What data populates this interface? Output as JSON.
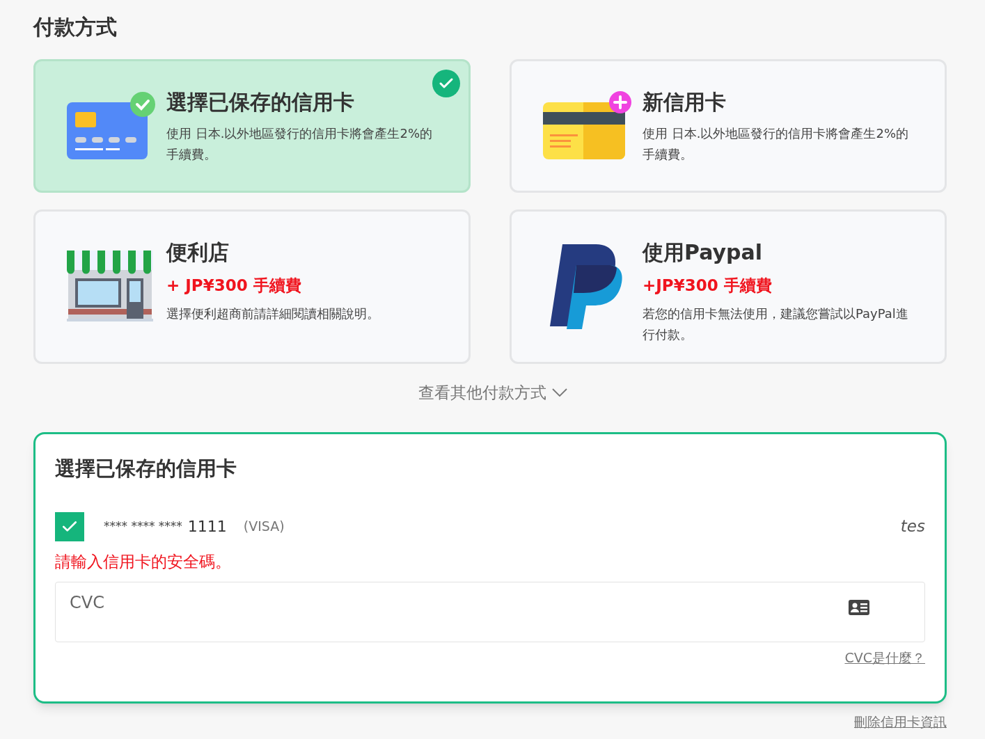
{
  "heading": "付款方式",
  "options": [
    {
      "kind": "saved_card",
      "title": "選擇已保存的信用卡",
      "description": "使用 日本.以外地區發行的信用卡將會產生2%的手續費。",
      "selected": true
    },
    {
      "kind": "new_card",
      "title": "新信用卡",
      "description": "使用 日本.以外地區發行的信用卡將會產生2%的手續費。",
      "selected": false
    },
    {
      "kind": "store",
      "title": "便利店",
      "fee": "+ JP¥300 手續費",
      "description": "選擇便利超商前請詳細閱讀相關說明。",
      "selected": false
    },
    {
      "kind": "paypal",
      "title": "使用Paypal",
      "fee": "+JP¥300 手續費",
      "description": "若您的信用卡無法使用，建議您嘗試以PayPal進行付款。",
      "selected": false
    }
  ],
  "more_methods": "查看其他付款方式",
  "saved_panel": {
    "title": "選擇已保存的信用卡",
    "card": {
      "mask": "**** **** ****",
      "last4": "1111",
      "brand": "(VISA)",
      "holder": "tes",
      "checked": true
    },
    "error": "請輸入信用卡的安全碼。",
    "cvc_placeholder": "CVC",
    "cvc_help": "CVC是什麼？"
  },
  "delete_link": "刪除信用卡資訊"
}
